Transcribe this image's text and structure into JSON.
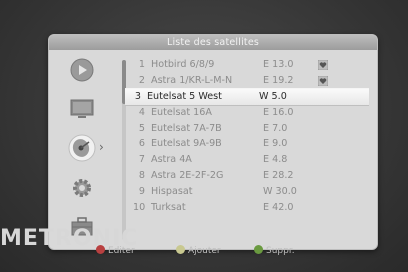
{
  "window": {
    "title": "Liste des satellites"
  },
  "sidebar": {
    "icons": [
      "play-icon",
      "tv-icon",
      "satellite-dish-icon",
      "settings-gear-icon",
      "toolbox-icon"
    ],
    "active_index": 2
  },
  "satellites": [
    {
      "number": "1",
      "name": "Hotbird 6/8/9",
      "position": "E 13.0",
      "favorite": true
    },
    {
      "number": "2",
      "name": "Astra 1/KR-L-M-N",
      "position": "E 19.2",
      "favorite": true
    },
    {
      "number": "3",
      "name": "Eutelsat 5 West",
      "position": "W 5.0",
      "favorite": false
    },
    {
      "number": "4",
      "name": "Eutelsat 16A",
      "position": "E 16.0",
      "favorite": false
    },
    {
      "number": "5",
      "name": "Eutelsat 7A-7B",
      "position": "E 7.0",
      "favorite": false
    },
    {
      "number": "6",
      "name": "Eutelsat 9A-9B",
      "position": "E 9.0",
      "favorite": false
    },
    {
      "number": "7",
      "name": "Astra 4A",
      "position": "E 4.8",
      "favorite": false
    },
    {
      "number": "8",
      "name": "Astra 2E-2F-2G",
      "position": "E 28.2",
      "favorite": false
    },
    {
      "number": "9",
      "name": "Hispasat",
      "position": "W 30.0",
      "favorite": false
    },
    {
      "number": "10",
      "name": "Turksat",
      "position": "E 42.0",
      "favorite": false
    }
  ],
  "selected_index": 2,
  "brand": {
    "logo_text": "METRONIC"
  },
  "footer": {
    "edit_label": "Editer",
    "add_label": "Ajouter",
    "delete_label": "Suppr.",
    "colors": {
      "red": "#b84040",
      "green": "#c8c890",
      "yellow": "#6a9a40"
    }
  }
}
